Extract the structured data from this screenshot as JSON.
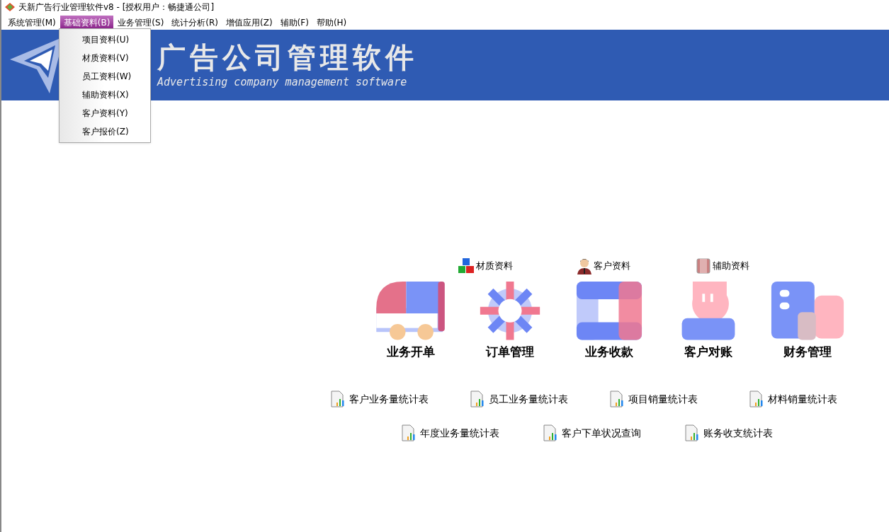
{
  "window": {
    "title": "天新广告行业管理软件v8 - [授权用户：畅捷通公司]"
  },
  "menu": [
    {
      "label": "系统管理(M)",
      "selected": false
    },
    {
      "label": "基础资料(B)",
      "selected": true
    },
    {
      "label": "业务管理(S)",
      "selected": false
    },
    {
      "label": "统计分析(R)",
      "selected": false
    },
    {
      "label": "增值应用(Z)",
      "selected": false
    },
    {
      "label": "辅助(F)",
      "selected": false
    },
    {
      "label": "帮助(H)",
      "selected": false
    }
  ],
  "dropdown": [
    "项目资料(U)",
    "材质资料(V)",
    "员工资料(W)",
    "辅助资料(X)",
    "客户资料(Y)",
    "客户报价(Z)"
  ],
  "banner": {
    "title": "广告公司管理软件",
    "subtitle": "Advertising company management software"
  },
  "quick_links": [
    {
      "label": "材质资料",
      "kind": "blocks"
    },
    {
      "label": "客户资料",
      "kind": "person"
    },
    {
      "label": "辅助资料",
      "kind": "book"
    }
  ],
  "modules": [
    {
      "label": "业务开单",
      "kind": "truck"
    },
    {
      "label": "订单管理",
      "kind": "gear"
    },
    {
      "label": "业务收款",
      "kind": "frame"
    },
    {
      "label": "客户对账",
      "kind": "person"
    },
    {
      "label": "财务管理",
      "kind": "building"
    }
  ],
  "reports": [
    [
      "客户业务量统计表",
      "员工业务量统计表",
      "项目销量统计表",
      "材料销量统计表"
    ],
    [
      "年度业务量统计表",
      "客户下单状况查询",
      "账务收支统计表"
    ]
  ]
}
